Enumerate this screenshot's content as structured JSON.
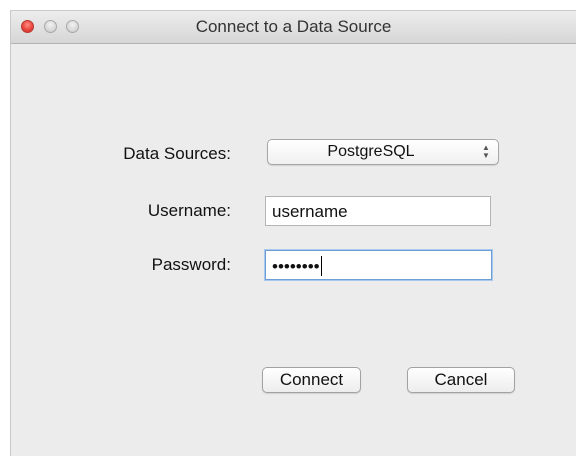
{
  "window": {
    "title": "Connect to a Data Source"
  },
  "form": {
    "data_sources_label": "Data Sources:",
    "data_sources_value": "PostgreSQL",
    "username_label": "Username:",
    "username_value": "username",
    "password_label": "Password:",
    "password_mask": "••••••••"
  },
  "buttons": {
    "connect_label": "Connect",
    "cancel_label": "Cancel"
  },
  "icons": {
    "close": "close-window-icon",
    "minimize": "minimize-window-icon",
    "zoom": "zoom-window-icon",
    "select_stepper": "up-down-arrows-icon"
  },
  "colors": {
    "window_bg": "#ececec",
    "close_button": "#e9473d",
    "focus_ring": "#6b9fd6"
  }
}
